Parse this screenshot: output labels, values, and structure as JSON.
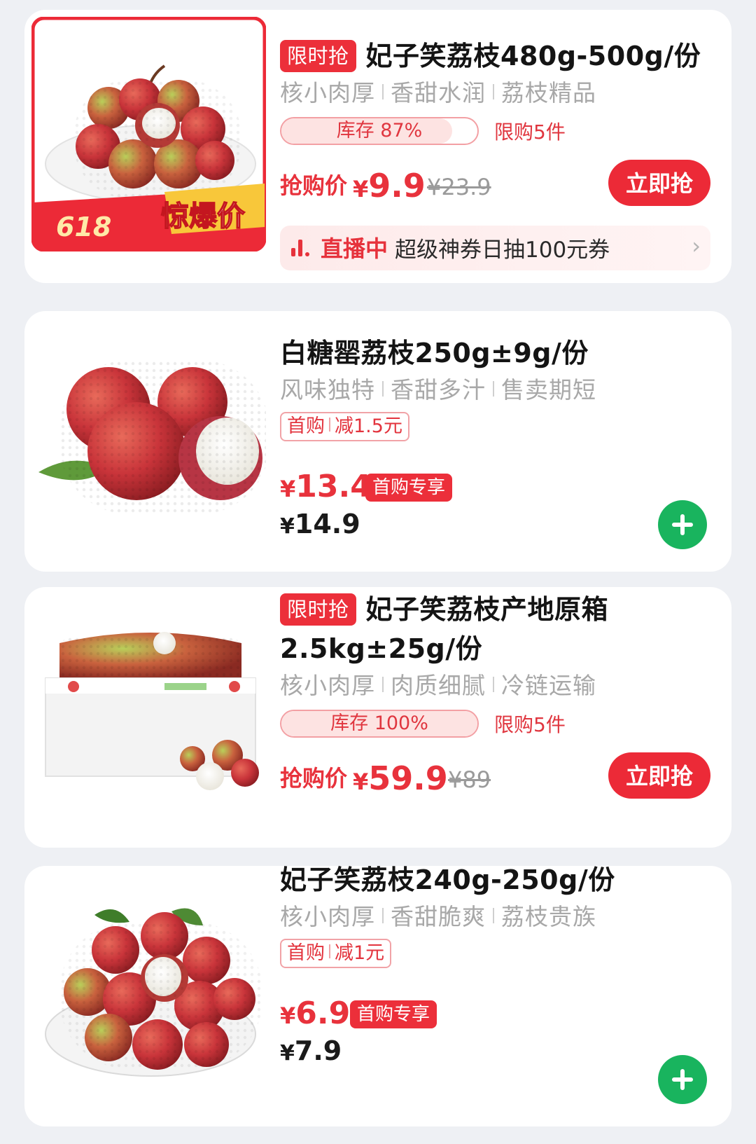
{
  "colors": {
    "accent_red": "#ec2f3a",
    "add_green": "#19b45e",
    "background": "#eef0f4"
  },
  "products": [
    {
      "flash_tag": "限时抢",
      "title": "妃子笑荔枝480g-500g/份",
      "features": [
        "核小肉厚",
        "香甜水润",
        "荔枝精品"
      ],
      "stock_text": "库存 87%",
      "stock_percent": 87,
      "limit_text": "限购5件",
      "price_label": "抢购价",
      "currency": "¥",
      "price": "9.9",
      "original_price": "¥23.9",
      "buy_button": "立即抢",
      "image_badges": {
        "event": "618",
        "promo": "惊爆价"
      },
      "live": {
        "label": "直播中",
        "text": "超级神券日抽100元券"
      }
    },
    {
      "title": "白糖罂荔枝250g±9g/份",
      "features": [
        "风味独特",
        "香甜多汁",
        "售卖期短"
      ],
      "coupon": {
        "type": "首购",
        "value": "减1.5元"
      },
      "currency": "¥",
      "member_price": "13.4",
      "member_tag": "首购专享",
      "regular_price": "14.9"
    },
    {
      "flash_tag": "限时抢",
      "title_line1": "妃子笑荔枝产地原箱",
      "title_line2": "2.5kg±25g/份",
      "features": [
        "核小肉厚",
        "肉质细腻",
        "冷链运输"
      ],
      "stock_text": "库存 100%",
      "stock_percent": 100,
      "limit_text": "限购5件",
      "price_label": "抢购价",
      "currency": "¥",
      "price": "59.9",
      "original_price": "¥89",
      "buy_button": "立即抢"
    },
    {
      "title": "妃子笑荔枝240g-250g/份",
      "features": [
        "核小肉厚",
        "香甜脆爽",
        "荔枝贵族"
      ],
      "coupon": {
        "type": "首购",
        "value": "减1元"
      },
      "currency": "¥",
      "member_price": "6.9",
      "member_tag": "首购专享",
      "regular_price": "7.9"
    }
  ]
}
